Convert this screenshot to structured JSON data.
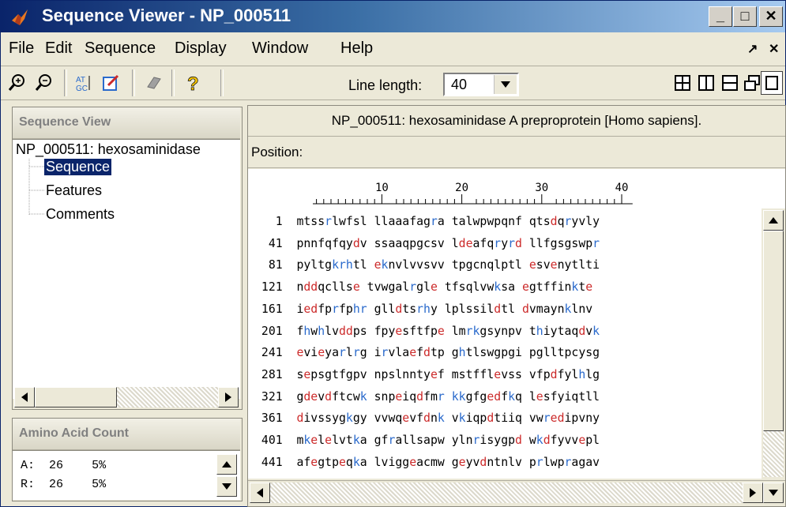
{
  "window": {
    "title": "Sequence Viewer - NP_000511",
    "min_label": "_",
    "max_label": "□",
    "close_label": "✕"
  },
  "menu": [
    "File",
    "Edit",
    "Sequence",
    "Display",
    "Window",
    "Help"
  ],
  "toolbar": {
    "line_length_label": "Line length:",
    "line_length_value": "40"
  },
  "sequence_view": {
    "title": "Sequence View",
    "root": "NP_000511: hexosaminidase",
    "children": [
      "Sequence",
      "Features",
      "Comments"
    ],
    "selected": "Sequence"
  },
  "amino_acid_count": {
    "title": "Amino Acid Count",
    "rows": [
      {
        "aa": "A:",
        "count": "26",
        "pct": "5%"
      },
      {
        "aa": "R:",
        "count": "26",
        "pct": "5%"
      }
    ]
  },
  "main": {
    "header": "NP_000511: hexosaminidase A preproprotein [Homo sapiens].",
    "position_label": "Position:",
    "ruler_labels": [
      "10",
      "20",
      "30",
      "40"
    ]
  },
  "sequence_rows": [
    {
      "num": "1",
      "seq": "mtssrlwfsl llaaafagra talwpwpqnf qtsdqryvly"
    },
    {
      "num": "41",
      "seq": "pnnfqfqydv ssaaqpgcsv ldeafqryrd llfgsgswpr"
    },
    {
      "num": "81",
      "seq": "pyltgkrhtl eknvlvvsvv tpgcnqlptl esvenytlti"
    },
    {
      "num": "121",
      "seq": "nddqcllse tvwgalrgle tfsqlvwksa egtffinkte"
    },
    {
      "num": "161",
      "seq": "iedfprfphr glldtsrhy lplssildtl dvmaynklnv"
    },
    {
      "num": "201",
      "seq": "fhwhlvddps fpyesftfpe lmrkgsynpv thiytaqdvk"
    },
    {
      "num": "241",
      "seq": "evieyarlrg irvlaefdtp ghtlswgpgi pglltpcysg"
    },
    {
      "num": "281",
      "seq": "sepsgtfgpv npslnntyef mstfflevss vfpdfylhlg"
    },
    {
      "num": "321",
      "seq": "gdevdftcwk snpeiqdfmr kkgfgedfkq lesfyiqtll"
    },
    {
      "num": "361",
      "seq": "divssygkgy vvwqevfdnk vkiqpdtiiq vwredipvny"
    },
    {
      "num": "401",
      "seq": "mkelelvtka gfrallsapw ylnrisygpd wkdfyvvepl"
    },
    {
      "num": "441",
      "seq": "afegtpeqka lviggeacmw geyvdntnlv prlwpragav"
    }
  ],
  "colors": {
    "acidic": "#cc2a2a",
    "basic": "#2a6acc",
    "selection": "#0a246a"
  }
}
